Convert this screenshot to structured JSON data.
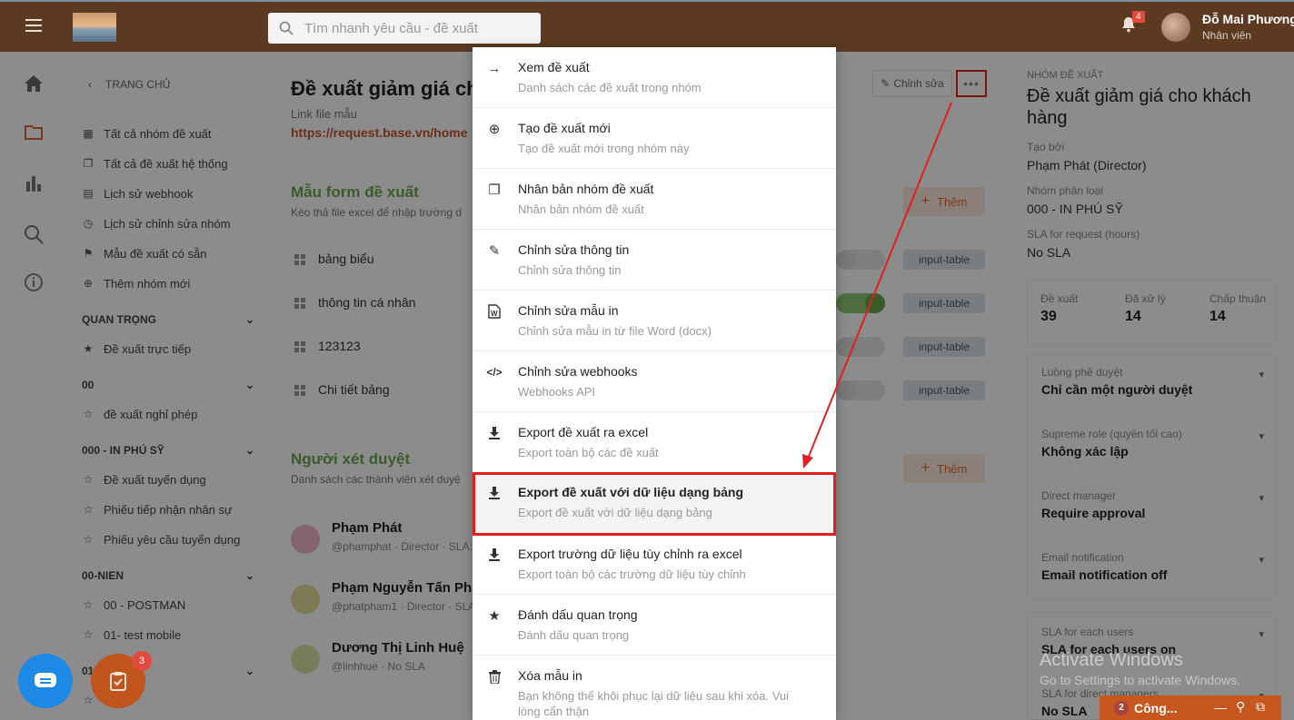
{
  "header": {
    "search_placeholder": "Tìm nhanh yêu cầu - đề xuất",
    "notif_count": "4",
    "user_name": "Đỗ Mai Phương",
    "user_role": "Nhân viên"
  },
  "nav": {
    "back": "TRANG CHỦ",
    "items": [
      "Tất cả nhóm đề xuất",
      "Tất cả đề xuất hệ thống",
      "Lịch sử webhook",
      "Lịch sử chỉnh sửa nhóm",
      "Mẫu đề xuất có sẵn",
      "Thêm nhóm mới"
    ],
    "sections": [
      {
        "title": "QUAN TRỌNG",
        "items": [
          "Đề xuất trực tiếp"
        ]
      },
      {
        "title": "00",
        "items": [
          "đề xuất nghỉ phép"
        ]
      },
      {
        "title": "000 - IN PHÚ SỸ",
        "items": [
          "Đề xuất tuyển dụng",
          "Phiếu tiếp nhận nhân sự",
          "Phiếu yêu cầu tuyển dụng"
        ]
      },
      {
        "title": "00-NIEN",
        "items": [
          "00 - POSTMAN",
          "01- test mobile"
        ]
      },
      {
        "title": "01"
      }
    ]
  },
  "main": {
    "title": "Đề xuất giảm giá ch",
    "file_label": "Link file mẫu",
    "file_link": "https://request.base.vn/home",
    "edit_label": "Chỉnh sửa",
    "form_section": {
      "title": "Mẫu form đề xuất",
      "desc": "Kéo thả file excel để nhập trường d",
      "add_label": "Thêm",
      "rows": [
        {
          "name": "bảng biểu",
          "tag": "input-table",
          "on": false
        },
        {
          "name": "thông tin cá nhân",
          "tag": "input-table",
          "on": true
        },
        {
          "name": "123123",
          "tag": "input-table",
          "on": false
        },
        {
          "name": "Chi tiết bảng",
          "tag": "input-table",
          "on": false
        }
      ]
    },
    "approver_section": {
      "title": "Người xét duyệt",
      "desc": "Danh sách các thành viên xét duyệ",
      "add_label": "Thêm",
      "people": [
        {
          "name": "Phạm Phát",
          "sub": "@phamphat · Director · SLA:"
        },
        {
          "name": "Phạm Nguyễn Tấn Phát",
          "sub": "@phatpham1 · Director · SLA"
        },
        {
          "name": "Dương Thị Linh Huệ",
          "sub": "@linhhue · No SLA"
        }
      ]
    }
  },
  "menu": [
    {
      "title": "Xem đề xuất",
      "desc": "Danh sách các đề xuất trong nhóm",
      "icon": "arrow-right-icon"
    },
    {
      "title": "Tạo đề xuất mới",
      "desc": "Tạo đề xuất mới trong nhóm này",
      "icon": "plus-circle-icon"
    },
    {
      "title": "Nhân bản nhóm đề xuất",
      "desc": "Nhân bản nhóm đề xuất",
      "icon": "copy-icon"
    },
    {
      "title": "Chỉnh sửa thông tin",
      "desc": "Chỉnh sửa thông tin",
      "icon": "pencil-icon"
    },
    {
      "title": "Chỉnh sửa mẫu in",
      "desc": "Chỉnh sửa mẫu in từ file Word (docx)",
      "icon": "word-icon"
    },
    {
      "title": "Chỉnh sửa webhooks",
      "desc": "Webhooks API",
      "icon": "code-icon"
    },
    {
      "title": "Export đề xuất ra excel",
      "desc": "Export toàn bộ các đề xuất",
      "icon": "download-icon"
    },
    {
      "title": "Export đề xuất với dữ liệu dạng bảng",
      "desc": "Export đề xuất với dữ liệu dạng bảng",
      "icon": "download-icon"
    },
    {
      "title": "Export trường dữ liệu tùy chỉnh ra excel",
      "desc": "Export toàn bộ các trường dữ liệu tùy chỉnh",
      "icon": "download-icon"
    },
    {
      "title": "Đánh dấu quan trọng",
      "desc": "Đánh dấu quan trọng",
      "icon": "star-icon"
    },
    {
      "title": "Xóa mẫu in",
      "desc": "Bạn không thể khôi phục lại dữ liệu sau khi xóa. Vui",
      "desc2": "lòng cẩn thận",
      "icon": "trash-icon"
    }
  ],
  "right": {
    "group_label": "NHÓM ĐỀ XUẤT",
    "group_title": "Đề xuất giảm giá cho khách hàng",
    "created_label": "Tạo bởi",
    "created_value": "Phạm Phát (Director)",
    "category_label": "Nhóm phân loại",
    "category_value": "000 - IN PHÚ SỸ",
    "sla_label": "SLA for request (hours)",
    "sla_value": "No SLA",
    "stats": [
      {
        "label": "Đề xuất",
        "value": "39"
      },
      {
        "label": "Đã xử lý",
        "value": "14"
      },
      {
        "label": "Chấp thuận",
        "value": "14"
      }
    ],
    "settings": [
      {
        "label": "Luồng phê duyệt",
        "value": "Chỉ cần một người duyệt"
      },
      {
        "label": "Supreme role (quyền tối cao)",
        "value": "Không xác lập"
      },
      {
        "label": "Direct manager",
        "value": "Require approval"
      },
      {
        "label": "Email notification",
        "value": "Email notification off"
      }
    ],
    "sla": [
      {
        "label": "SLA for each users",
        "value": "SLA for each users on"
      },
      {
        "label": "SLA for direct managers",
        "value": "No SLA"
      }
    ]
  },
  "watermark": {
    "line1": "Activate Windows",
    "line2": "Go to Settings to activate Windows."
  },
  "dock": {
    "count": "2",
    "label": "Công..."
  },
  "task_count": "3"
}
